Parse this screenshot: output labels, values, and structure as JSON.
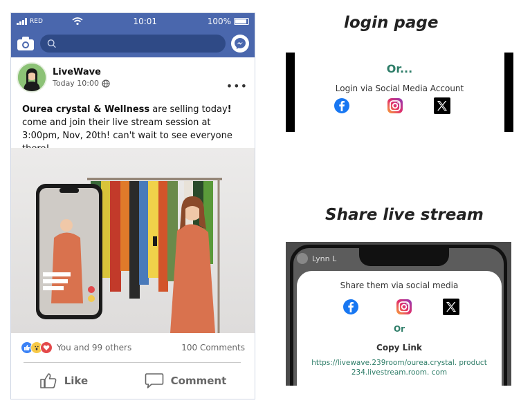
{
  "status_bar": {
    "carrier": "RED",
    "time": "10:01",
    "battery": "100%"
  },
  "search": {
    "placeholder": ""
  },
  "post": {
    "author": "LiveWave",
    "timestamp": "Today 10:00",
    "text_bold": "Ourea crystal & Wellness",
    "text_mid": " are selling today",
    "text_bang": "!",
    "text_rest": " come and join their live stream session at 3:00pm, Nov, 20th! can't wait to see everyone there!",
    "more": "•••"
  },
  "reactions": {
    "summary": "You and 99 others",
    "comments": "100 Comments"
  },
  "actions": {
    "like": "Like",
    "comment": "Comment"
  },
  "login_section": {
    "heading": "login page",
    "or": "Or...",
    "subtitle": "Login via Social Media Account"
  },
  "share_section": {
    "heading": "Share live stream",
    "viewer": "Lynn L",
    "title": "Share them via social media",
    "or": "Or",
    "copy_link": "Copy Link",
    "url": "https://livewave.239room/ourea.crystal. product 234.livestream.room. com"
  },
  "colors": {
    "brand_blue": "#4a67ad",
    "accent_green": "#2e7d68",
    "facebook": "#1877f2"
  }
}
